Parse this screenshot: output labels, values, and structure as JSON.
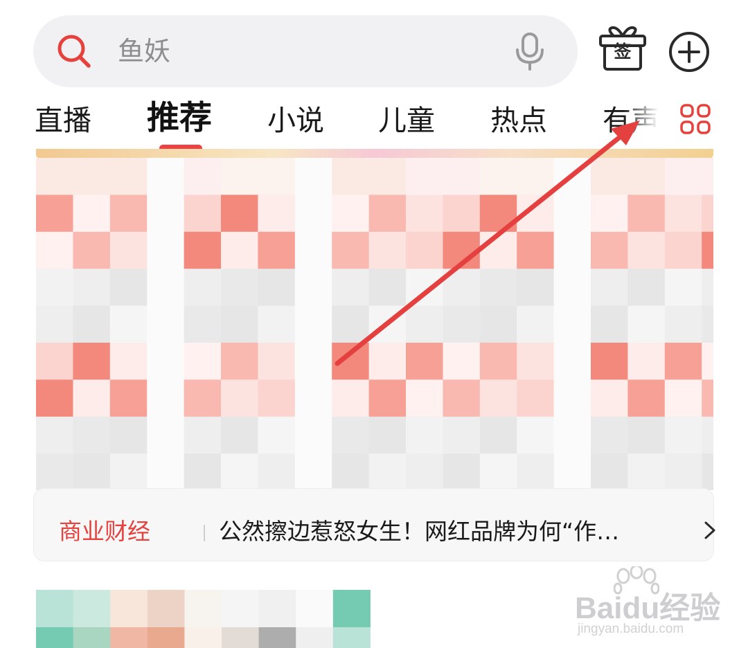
{
  "search": {
    "placeholder": "鱼妖",
    "icon": "search-icon",
    "voice_icon": "mic-icon"
  },
  "header_actions": {
    "gift_char": "签",
    "gift_icon": "gift-checkin-icon",
    "add_icon": "plus-circle-icon"
  },
  "tabs": [
    {
      "label": "直播",
      "active": false
    },
    {
      "label": "推荐",
      "active": true
    },
    {
      "label": "小说",
      "active": false
    },
    {
      "label": "儿童",
      "active": false
    },
    {
      "label": "热点",
      "active": false
    },
    {
      "label": "有声",
      "active": false
    }
  ],
  "more_tabs_icon": "grid-icon",
  "headline": {
    "category": "商业财经",
    "title": "公然擦边惹怒女生！网红品牌为何“作…",
    "chevron_icon": "chevron-right-icon"
  },
  "watermark": {
    "logo": "Baidu经验",
    "url": "jingyan.baidu.com"
  },
  "colors": {
    "accent": "#e5413d",
    "search_bg": "#f1f1f3",
    "card_bg": "#f7f7f8",
    "annotation_arrow": "#e3403f"
  }
}
